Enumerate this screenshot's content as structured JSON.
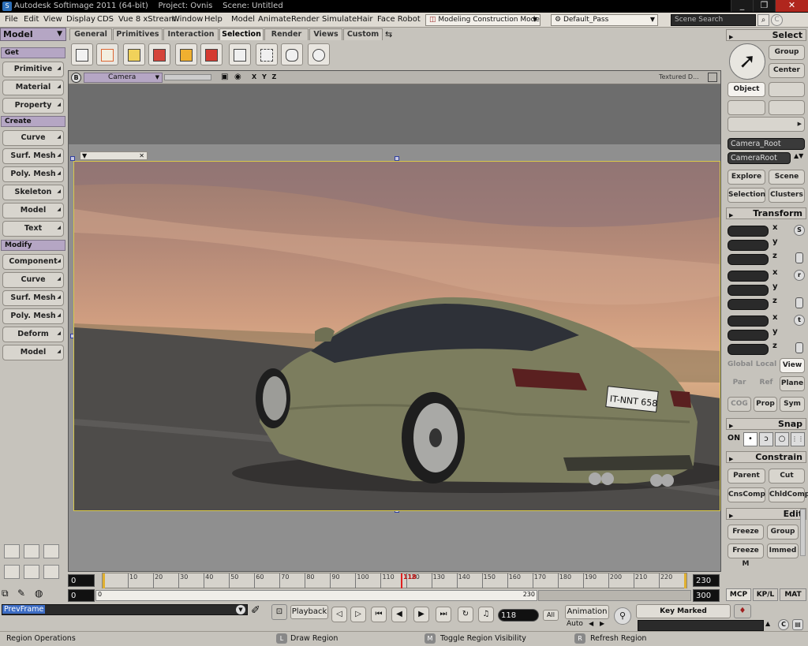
{
  "window": {
    "title": "Autodesk Softimage 2011 (64-bit)",
    "project": "Project: Ovnis",
    "scene": "Scene: Untitled"
  },
  "menu": {
    "items": [
      "File",
      "Edit",
      "View",
      "CDS",
      "Vue 8 xStream",
      "Window",
      "Help"
    ],
    "modules": [
      "Model",
      "Animate",
      "Render",
      "Simulate",
      "Hair",
      "Face Robot"
    ],
    "construction_mode": "Modeling Construction Mode",
    "pass": "Default_Pass",
    "search_placeholder": "Scene Search"
  },
  "left": {
    "module": "Model",
    "sections": [
      {
        "header": "Get",
        "buttons": [
          "Primitive",
          "Material",
          "Property"
        ]
      },
      {
        "header": "Create",
        "buttons": [
          "Curve",
          "Surf. Mesh",
          "Poly. Mesh",
          "Skeleton",
          "Model",
          "Text"
        ]
      },
      {
        "header": "Modify",
        "buttons": [
          "Component",
          "Curve",
          "Surf. Mesh",
          "Poly. Mesh",
          "Deform",
          "Model"
        ]
      }
    ]
  },
  "toolbar": {
    "tabs": [
      "General",
      "Primitives",
      "Interaction",
      "Selection",
      "Render",
      "Views",
      "Custom"
    ],
    "active_tab": "Selection"
  },
  "viewport": {
    "label": "B",
    "camera": "Camera",
    "axes": "X Y Z",
    "display_mode": "Textured D...",
    "plate_text": "IT-NNT 658"
  },
  "timeline": {
    "start": "0",
    "end": "230",
    "range_start": "0",
    "range_end": "300",
    "current": "118",
    "current_marker": "118",
    "mid_end": "230",
    "ticks": [
      "10",
      "20",
      "30",
      "40",
      "50",
      "60",
      "70",
      "80",
      "90",
      "100",
      "110",
      "120",
      "130",
      "140",
      "150",
      "160",
      "170",
      "180",
      "190",
      "200",
      "210",
      "220"
    ]
  },
  "right": {
    "select_header": "Select",
    "select_buttons": [
      "Group",
      "Center",
      "Object"
    ],
    "camera_root": "Camera_Root",
    "camera_root2": "CameraRoot",
    "explore": "Explore",
    "scene": "Scene",
    "selection": "Selection",
    "clusters": "Clusters",
    "transform_header": "Transform",
    "axes": [
      "x",
      "y",
      "z"
    ],
    "transform_icons": [
      "S",
      "r",
      "t"
    ],
    "space": [
      "Global",
      "Local",
      "View"
    ],
    "space2": [
      "Par",
      "Ref",
      "Plane"
    ],
    "space3": [
      "COG",
      "Prop",
      "Sym"
    ],
    "snap_header": "Snap",
    "snap_on": "ON",
    "constrain_header": "Constrain",
    "constrain_buttons": [
      "Parent",
      "Cut",
      "CnsComp",
      "ChldComp"
    ],
    "edit_header": "Edit",
    "edit_buttons": [
      "Freeze",
      "Group",
      "Freeze M",
      "Immed"
    ],
    "bottom_tabs": [
      "MCP",
      "KP/L",
      "MAT"
    ]
  },
  "bottom": {
    "command": "PrevFrame",
    "playback": "Playback",
    "frame": "118",
    "all": "All",
    "animation": "Animation",
    "auto": "Auto",
    "key_marked": "Key Marked Parameters",
    "status_left": "Region Operations",
    "hints": [
      {
        "key": "L",
        "text": "Draw Region"
      },
      {
        "key": "M",
        "text": "Toggle Region Visibility"
      },
      {
        "key": "R",
        "text": "Refresh Region"
      }
    ]
  },
  "colors": {
    "accent_purple": "#b5a6c4",
    "panel_bg": "#c6c3bc",
    "time_marker": "#e02020",
    "title_bar": "#000000"
  }
}
